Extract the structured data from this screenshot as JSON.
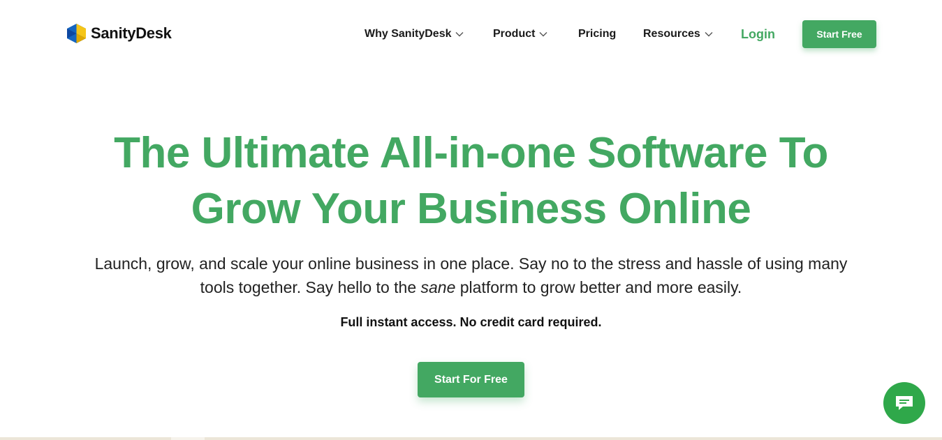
{
  "brand": {
    "name": "SanityDesk",
    "colors": {
      "primary_green": "#43a862",
      "chat_green": "#2fa84a",
      "logo_blue": "#1565c0",
      "logo_yellow": "#f5c518"
    }
  },
  "nav": {
    "items": [
      {
        "label": "Why SanityDesk",
        "has_dropdown": true
      },
      {
        "label": "Product",
        "has_dropdown": true
      },
      {
        "label": "Pricing",
        "has_dropdown": false
      },
      {
        "label": "Resources",
        "has_dropdown": true
      }
    ],
    "login_label": "Login",
    "start_free_label": "Start Free"
  },
  "hero": {
    "title_line1": "The Ultimate All-in-one Software To",
    "title_line2": "Grow Your Business Online",
    "subtitle_line1": "Launch, grow, and scale your online business in one place. Say no to the stress and hassle of using many",
    "subtitle_line2_before": "tools together. Say hello to the ",
    "subtitle_line2_emph": "sane",
    "subtitle_line2_after": " platform to grow better and more easily.",
    "note": "Full instant access. No credit card required.",
    "cta_label": "Start For Free"
  },
  "icons": {
    "chat": "chat-bubble-icon",
    "chevron": "chevron-down-icon"
  }
}
